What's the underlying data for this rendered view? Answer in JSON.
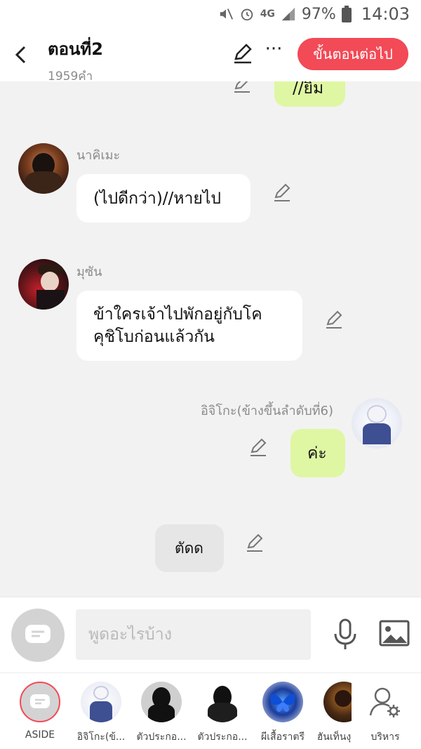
{
  "status_bar": {
    "network": "4G",
    "battery": "97%",
    "time": "14:03"
  },
  "header": {
    "title": "ตอนที่2",
    "word_count": "1959คำ",
    "next_label": "ขั้นตอนต่อไป"
  },
  "messages": [
    {
      "sender": "",
      "text": "//ยิ้ม",
      "side": "right"
    },
    {
      "sender": "นาคิเมะ",
      "text": "(ไปดีกว่า)//หายไป",
      "side": "left"
    },
    {
      "sender": "มุซัน",
      "text_line1": "ข้าใครเจ้าไปพักอยู่กับโค",
      "text_line2": "คุชิโบก่อนแล้วกัน",
      "side": "left"
    },
    {
      "sender": "อิจิโกะ(ข้างขึ้นลำดับที่6)",
      "text": "ค่ะ",
      "side": "right"
    },
    {
      "sender": "",
      "text": "ตัดด",
      "side": "center"
    }
  ],
  "input": {
    "placeholder": "พูดอะไรบ้าง"
  },
  "characters": [
    {
      "label": "ASIDE"
    },
    {
      "label": "อิจิโกะ(ข้..."
    },
    {
      "label": "ตัวประกอ..."
    },
    {
      "label": "ตัวประกอ..."
    },
    {
      "label": "ผีเสื้อราตรี"
    },
    {
      "label": "ฮันเท็นงุ"
    },
    {
      "label": "บริหาร"
    }
  ],
  "colors": {
    "accent_red": "#f24a56",
    "bubble_green": "#dff7a3",
    "background": "#f2f2f2"
  }
}
